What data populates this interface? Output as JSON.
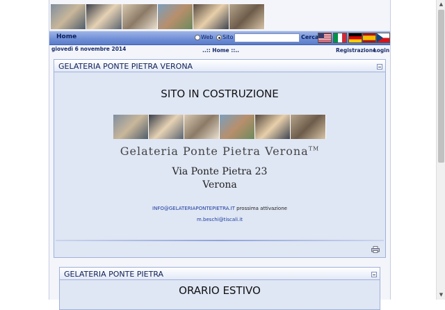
{
  "nav": {
    "home": "Home",
    "search_web": "Web",
    "search_site": "Sito",
    "search_value": "",
    "search_button": "Cerca",
    "flags": [
      "us-flag-icon",
      "it-flag-icon",
      "de-flag-icon",
      "es-flag-icon",
      "cz-flag-icon"
    ]
  },
  "info": {
    "date": "giovedì 6 novembre 2014",
    "breadcrumb": "..:: Home ::..",
    "register": "Registrazione",
    "login": "Login"
  },
  "module1": {
    "title": "GELATERIA PONTE PIETRA VERONA",
    "heading": "SITO IN COSTRUZIONE",
    "brand": "Gelateria Ponte Pietra Verona",
    "brand_mark": "TM",
    "address_line1": "Via Ponte Pietra 23",
    "address_line2": "Verona",
    "email": "INFO@GELATERIAPONTEPIETRA.IT",
    "email_note": " prossima attivazione",
    "email2": "m.beschi@tiscali.it"
  },
  "module2": {
    "title": "GELATERIA PONTE PIETRA",
    "heading": "ORARIO ESTIVO"
  },
  "colors": {
    "nav_bg": "#6f8ed6",
    "link": "#1a3a9c",
    "module_bg": "#dfe6f4"
  }
}
